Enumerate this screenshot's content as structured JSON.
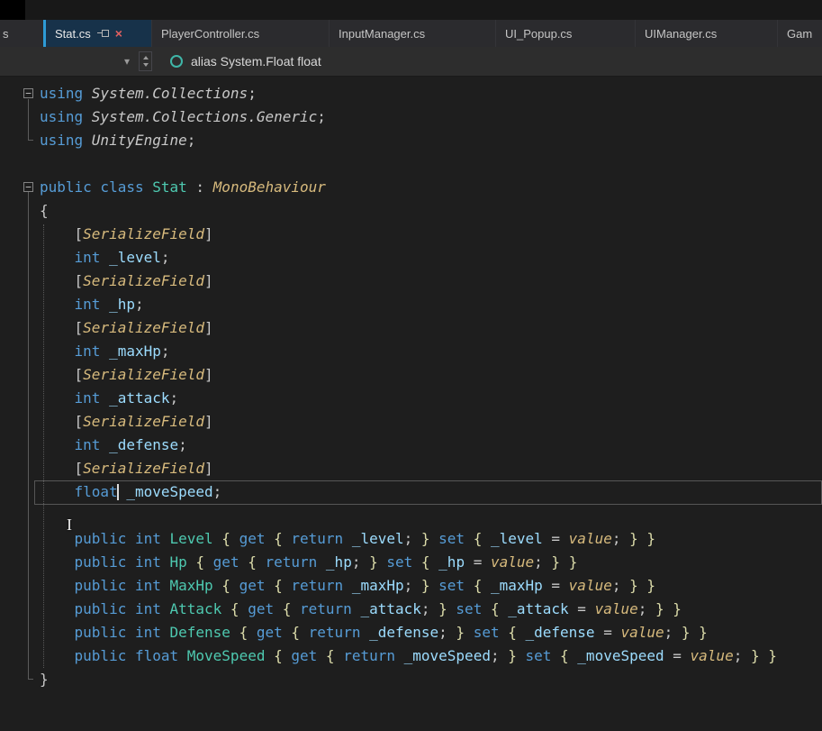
{
  "tabs": {
    "partial_left_label": "s",
    "active": {
      "label": "Stat.cs"
    },
    "items": [
      "PlayerController.cs",
      "InputManager.cs",
      "UI_Popup.cs",
      "UIManager.cs",
      "Gam"
    ]
  },
  "icons": {
    "close": "×",
    "dropdown_caret": "▾",
    "fold_collapse": "−"
  },
  "navbar": {
    "alias_text": "alias System.Float float"
  },
  "colors": {
    "accent": "#2e9bd6",
    "close_red": "#e06060",
    "keyword_blue": "#569CD6",
    "type_teal": "#4EC9B0",
    "attribute_gold": "#D7BA7D",
    "field_blue": "#9CDCFE",
    "brace_gold": "#DCDCAA",
    "editor_bg": "#1e1e1e"
  },
  "editor": {
    "lines": [
      {
        "fold": true,
        "tokens": [
          {
            "c": "k",
            "t": "using "
          },
          {
            "c": "n",
            "t": "System.Collections"
          },
          {
            "c": "p",
            "t": ";"
          }
        ]
      },
      {
        "tokens": [
          {
            "c": "k",
            "t": "using "
          },
          {
            "c": "n",
            "t": "System.Collections.Generic"
          },
          {
            "c": "p",
            "t": ";"
          }
        ]
      },
      {
        "tokens": [
          {
            "c": "k",
            "t": "using "
          },
          {
            "c": "n",
            "t": "UnityEngine"
          },
          {
            "c": "p",
            "t": ";"
          }
        ]
      },
      {
        "tokens": []
      },
      {
        "fold": true,
        "tokens": [
          {
            "c": "k",
            "t": "public class "
          },
          {
            "c": "t",
            "t": "Stat"
          },
          {
            "c": "p",
            "t": " : "
          },
          {
            "c": "a",
            "t": "MonoBehaviour"
          }
        ]
      },
      {
        "tokens": [
          {
            "c": "p",
            "t": "{"
          }
        ]
      },
      {
        "tokens": [
          {
            "c": "p",
            "t": "    ["
          },
          {
            "c": "a",
            "t": "SerializeField"
          },
          {
            "c": "p",
            "t": "]"
          }
        ]
      },
      {
        "tokens": [
          {
            "c": "p",
            "t": "    "
          },
          {
            "c": "k",
            "t": "int"
          },
          {
            "c": "p",
            "t": " "
          },
          {
            "c": "f",
            "t": "_level"
          },
          {
            "c": "p",
            "t": ";"
          }
        ]
      },
      {
        "tokens": [
          {
            "c": "p",
            "t": "    ["
          },
          {
            "c": "a",
            "t": "SerializeField"
          },
          {
            "c": "p",
            "t": "]"
          }
        ]
      },
      {
        "tokens": [
          {
            "c": "p",
            "t": "    "
          },
          {
            "c": "k",
            "t": "int"
          },
          {
            "c": "p",
            "t": " "
          },
          {
            "c": "f",
            "t": "_hp"
          },
          {
            "c": "p",
            "t": ";"
          }
        ]
      },
      {
        "tokens": [
          {
            "c": "p",
            "t": "    ["
          },
          {
            "c": "a",
            "t": "SerializeField"
          },
          {
            "c": "p",
            "t": "]"
          }
        ]
      },
      {
        "tokens": [
          {
            "c": "p",
            "t": "    "
          },
          {
            "c": "k",
            "t": "int"
          },
          {
            "c": "p",
            "t": " "
          },
          {
            "c": "f",
            "t": "_maxHp"
          },
          {
            "c": "p",
            "t": ";"
          }
        ]
      },
      {
        "tokens": [
          {
            "c": "p",
            "t": "    ["
          },
          {
            "c": "a",
            "t": "SerializeField"
          },
          {
            "c": "p",
            "t": "]"
          }
        ]
      },
      {
        "tokens": [
          {
            "c": "p",
            "t": "    "
          },
          {
            "c": "k",
            "t": "int"
          },
          {
            "c": "p",
            "t": " "
          },
          {
            "c": "f",
            "t": "_attack"
          },
          {
            "c": "p",
            "t": ";"
          }
        ]
      },
      {
        "tokens": [
          {
            "c": "p",
            "t": "    ["
          },
          {
            "c": "a",
            "t": "SerializeField"
          },
          {
            "c": "p",
            "t": "]"
          }
        ]
      },
      {
        "tokens": [
          {
            "c": "p",
            "t": "    "
          },
          {
            "c": "k",
            "t": "int"
          },
          {
            "c": "p",
            "t": " "
          },
          {
            "c": "f",
            "t": "_defense"
          },
          {
            "c": "p",
            "t": ";"
          }
        ]
      },
      {
        "tokens": [
          {
            "c": "p",
            "t": "    ["
          },
          {
            "c": "a",
            "t": "SerializeField"
          },
          {
            "c": "p",
            "t": "]"
          }
        ]
      },
      {
        "current": true,
        "tokens": [
          {
            "c": "p",
            "t": "    "
          },
          {
            "c": "k",
            "t": "float"
          },
          {
            "caret": true
          },
          {
            "c": "p",
            "t": " "
          },
          {
            "c": "f",
            "t": "_moveSpeed"
          },
          {
            "c": "p",
            "t": ";"
          }
        ]
      },
      {
        "tokens": []
      },
      {
        "tokens": [
          {
            "c": "p",
            "t": "    "
          },
          {
            "c": "k",
            "t": "public int "
          },
          {
            "c": "t",
            "t": "Level"
          },
          {
            "c": "b",
            "t": " { "
          },
          {
            "c": "k",
            "t": "get"
          },
          {
            "c": "b",
            "t": " { "
          },
          {
            "c": "k",
            "t": "return"
          },
          {
            "c": "p",
            "t": " "
          },
          {
            "c": "f",
            "t": "_level"
          },
          {
            "c": "p",
            "t": "; "
          },
          {
            "c": "b",
            "t": "} "
          },
          {
            "c": "k",
            "t": "set"
          },
          {
            "c": "b",
            "t": " { "
          },
          {
            "c": "f",
            "t": "_level"
          },
          {
            "c": "p",
            "t": " = "
          },
          {
            "c": "v",
            "t": "value"
          },
          {
            "c": "p",
            "t": "; "
          },
          {
            "c": "b",
            "t": "} }"
          }
        ]
      },
      {
        "tokens": [
          {
            "c": "p",
            "t": "    "
          },
          {
            "c": "k",
            "t": "public int "
          },
          {
            "c": "t",
            "t": "Hp"
          },
          {
            "c": "b",
            "t": " { "
          },
          {
            "c": "k",
            "t": "get"
          },
          {
            "c": "b",
            "t": " { "
          },
          {
            "c": "k",
            "t": "return"
          },
          {
            "c": "p",
            "t": " "
          },
          {
            "c": "f",
            "t": "_hp"
          },
          {
            "c": "p",
            "t": "; "
          },
          {
            "c": "b",
            "t": "} "
          },
          {
            "c": "k",
            "t": "set"
          },
          {
            "c": "b",
            "t": " { "
          },
          {
            "c": "f",
            "t": "_hp"
          },
          {
            "c": "p",
            "t": " = "
          },
          {
            "c": "v",
            "t": "value"
          },
          {
            "c": "p",
            "t": "; "
          },
          {
            "c": "b",
            "t": "} }"
          }
        ]
      },
      {
        "tokens": [
          {
            "c": "p",
            "t": "    "
          },
          {
            "c": "k",
            "t": "public int "
          },
          {
            "c": "t",
            "t": "MaxHp"
          },
          {
            "c": "b",
            "t": " { "
          },
          {
            "c": "k",
            "t": "get"
          },
          {
            "c": "b",
            "t": " { "
          },
          {
            "c": "k",
            "t": "return"
          },
          {
            "c": "p",
            "t": " "
          },
          {
            "c": "f",
            "t": "_maxHp"
          },
          {
            "c": "p",
            "t": "; "
          },
          {
            "c": "b",
            "t": "} "
          },
          {
            "c": "k",
            "t": "set"
          },
          {
            "c": "b",
            "t": " { "
          },
          {
            "c": "f",
            "t": "_maxHp"
          },
          {
            "c": "p",
            "t": " = "
          },
          {
            "c": "v",
            "t": "value"
          },
          {
            "c": "p",
            "t": "; "
          },
          {
            "c": "b",
            "t": "} }"
          }
        ]
      },
      {
        "tokens": [
          {
            "c": "p",
            "t": "    "
          },
          {
            "c": "k",
            "t": "public int "
          },
          {
            "c": "t",
            "t": "Attack"
          },
          {
            "c": "b",
            "t": " { "
          },
          {
            "c": "k",
            "t": "get"
          },
          {
            "c": "b",
            "t": " { "
          },
          {
            "c": "k",
            "t": "return"
          },
          {
            "c": "p",
            "t": " "
          },
          {
            "c": "f",
            "t": "_attack"
          },
          {
            "c": "p",
            "t": "; "
          },
          {
            "c": "b",
            "t": "} "
          },
          {
            "c": "k",
            "t": "set"
          },
          {
            "c": "b",
            "t": " { "
          },
          {
            "c": "f",
            "t": "_attack"
          },
          {
            "c": "p",
            "t": " = "
          },
          {
            "c": "v",
            "t": "value"
          },
          {
            "c": "p",
            "t": "; "
          },
          {
            "c": "b",
            "t": "} }"
          }
        ]
      },
      {
        "tokens": [
          {
            "c": "p",
            "t": "    "
          },
          {
            "c": "k",
            "t": "public int "
          },
          {
            "c": "t",
            "t": "Defense"
          },
          {
            "c": "b",
            "t": " { "
          },
          {
            "c": "k",
            "t": "get"
          },
          {
            "c": "b",
            "t": " { "
          },
          {
            "c": "k",
            "t": "return"
          },
          {
            "c": "p",
            "t": " "
          },
          {
            "c": "f",
            "t": "_defense"
          },
          {
            "c": "p",
            "t": "; "
          },
          {
            "c": "b",
            "t": "} "
          },
          {
            "c": "k",
            "t": "set"
          },
          {
            "c": "b",
            "t": " { "
          },
          {
            "c": "f",
            "t": "_defense"
          },
          {
            "c": "p",
            "t": " = "
          },
          {
            "c": "v",
            "t": "value"
          },
          {
            "c": "p",
            "t": "; "
          },
          {
            "c": "b",
            "t": "} }"
          }
        ]
      },
      {
        "tokens": [
          {
            "c": "p",
            "t": "    "
          },
          {
            "c": "k",
            "t": "public float "
          },
          {
            "c": "t",
            "t": "MoveSpeed"
          },
          {
            "c": "b",
            "t": " { "
          },
          {
            "c": "k",
            "t": "get"
          },
          {
            "c": "b",
            "t": " { "
          },
          {
            "c": "k",
            "t": "return"
          },
          {
            "c": "p",
            "t": " "
          },
          {
            "c": "f",
            "t": "_moveSpeed"
          },
          {
            "c": "p",
            "t": "; "
          },
          {
            "c": "b",
            "t": "} "
          },
          {
            "c": "k",
            "t": "set"
          },
          {
            "c": "b",
            "t": " { "
          },
          {
            "c": "f",
            "t": "_moveSpeed"
          },
          {
            "c": "p",
            "t": " = "
          },
          {
            "c": "v",
            "t": "value"
          },
          {
            "c": "p",
            "t": "; "
          },
          {
            "c": "b",
            "t": "} }"
          }
        ]
      },
      {
        "tokens": [
          {
            "c": "p",
            "t": "}"
          }
        ]
      }
    ]
  }
}
